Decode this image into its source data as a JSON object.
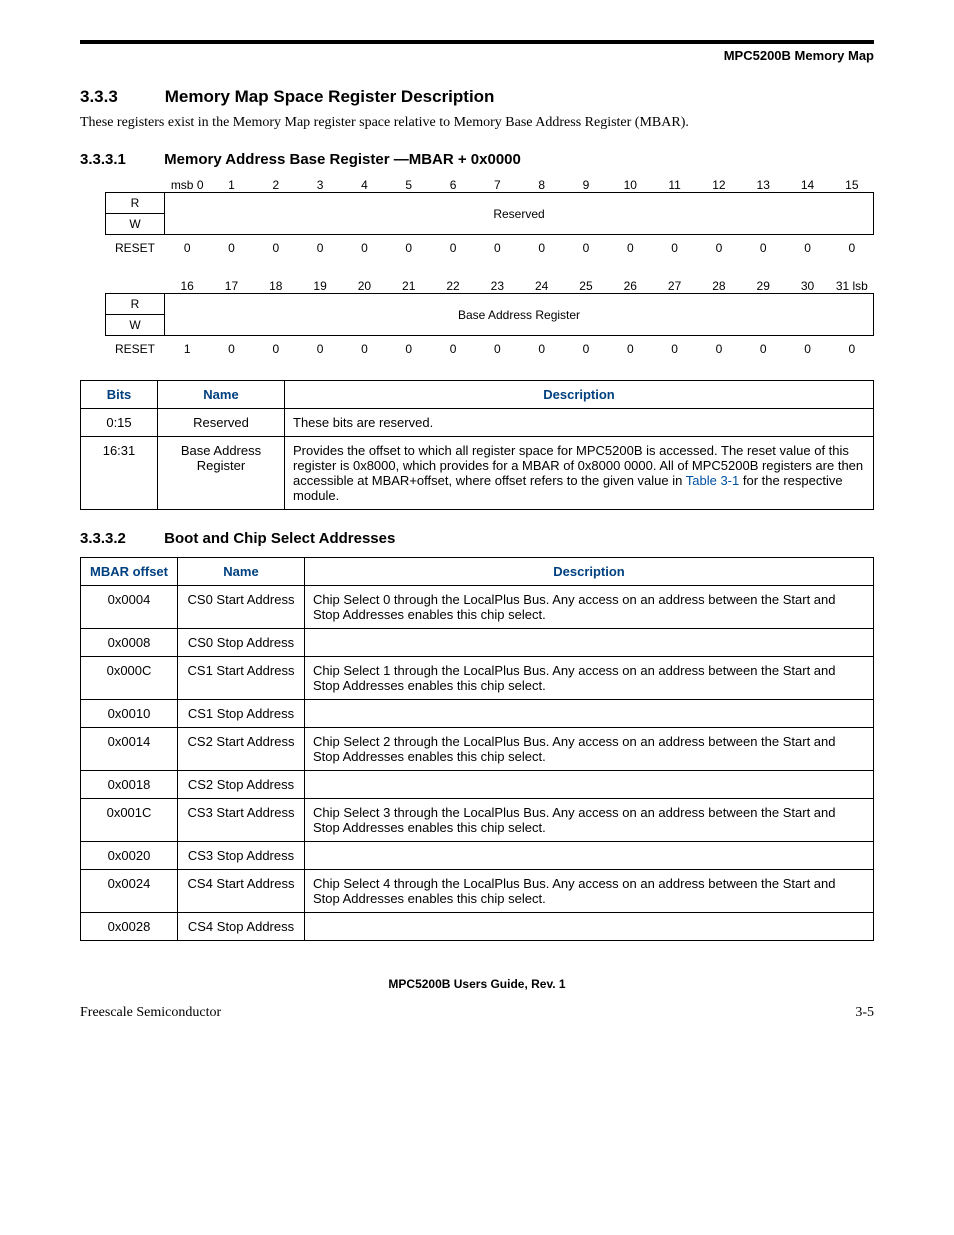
{
  "header": {
    "title": "MPC5200B Memory Map"
  },
  "section": {
    "num": "3.3.3",
    "title": "Memory Map Space Register Description",
    "intro": "These registers exist in the Memory Map register space relative to Memory Base Address Register (MBAR)."
  },
  "sub1": {
    "num": "3.3.3.1",
    "title": "Memory Address Base Register —MBAR + 0x0000"
  },
  "reg": {
    "bits_top": [
      "msb 0",
      "1",
      "2",
      "3",
      "4",
      "5",
      "6",
      "7",
      "8",
      "9",
      "10",
      "11",
      "12",
      "13",
      "14",
      "15"
    ],
    "rw_r": "R",
    "rw_w": "W",
    "field_top": "Reserved",
    "reset_label": "RESET",
    "reset_top": [
      "0",
      "0",
      "0",
      "0",
      "0",
      "0",
      "0",
      "0",
      "0",
      "0",
      "0",
      "0",
      "0",
      "0",
      "0",
      "0"
    ],
    "bits_bot": [
      "16",
      "17",
      "18",
      "19",
      "20",
      "21",
      "22",
      "23",
      "24",
      "25",
      "26",
      "27",
      "28",
      "29",
      "30",
      "31 lsb"
    ],
    "field_bot": "Base Address Register",
    "reset_bot": [
      "1",
      "0",
      "0",
      "0",
      "0",
      "0",
      "0",
      "0",
      "0",
      "0",
      "0",
      "0",
      "0",
      "0",
      "0",
      "0"
    ]
  },
  "table1": {
    "headers": [
      "Bits",
      "Name",
      "Description"
    ],
    "rows": [
      {
        "bits": "0:15",
        "name": "Reserved",
        "desc": "These bits are reserved."
      },
      {
        "bits": "16:31",
        "name": "Base Address Register",
        "desc_a": "Provides the offset to which all register space for MPC5200B is accessed. The reset value of this register is 0x8000, which provides for a MBAR of 0x8000 0000. All of MPC5200B registers are then accessible at MBAR+offset, where offset refers to the given value in ",
        "desc_link": "Table 3-1",
        "desc_b": " for the respective module."
      }
    ]
  },
  "sub2": {
    "num": "3.3.3.2",
    "title": "Boot and Chip Select Addresses"
  },
  "table2": {
    "headers": [
      "MBAR offset",
      "Name",
      "Description"
    ],
    "rows": [
      {
        "off": "0x0004",
        "name": "CS0 Start Address",
        "desc": "Chip Select 0 through the LocalPlus Bus. Any access on an address between the Start and Stop Addresses enables this chip select."
      },
      {
        "off": "0x0008",
        "name": "CS0 Stop Address",
        "desc": ""
      },
      {
        "off": "0x000C",
        "name": "CS1 Start Address",
        "desc": "Chip Select 1 through the LocalPlus Bus. Any access on an address between the Start and Stop Addresses enables this chip select."
      },
      {
        "off": "0x0010",
        "name": "CS1 Stop Address",
        "desc": ""
      },
      {
        "off": "0x0014",
        "name": "CS2 Start Address",
        "desc": "Chip Select 2 through the LocalPlus Bus. Any access on an address between the Start and Stop Addresses enables this chip select."
      },
      {
        "off": "0x0018",
        "name": "CS2 Stop Address",
        "desc": ""
      },
      {
        "off": "0x001C",
        "name": "CS3 Start Address",
        "desc": "Chip Select 3 through the LocalPlus Bus. Any access on an address between the Start and Stop Addresses enables this chip select."
      },
      {
        "off": "0x0020",
        "name": "CS3 Stop Address",
        "desc": ""
      },
      {
        "off": "0x0024",
        "name": "CS4 Start Address",
        "desc": "Chip Select 4 through the LocalPlus Bus. Any access on an address between the Start and Stop Addresses enables this chip select."
      },
      {
        "off": "0x0028",
        "name": "CS4 Stop Address",
        "desc": ""
      }
    ]
  },
  "footer": {
    "center": "MPC5200B Users Guide, Rev. 1",
    "left": "Freescale Semiconductor",
    "right": "3-5"
  }
}
